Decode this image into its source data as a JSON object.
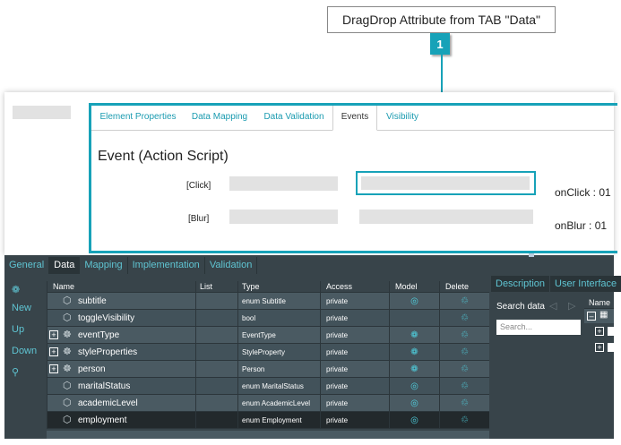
{
  "callout": {
    "text": "DragDrop Attribute from TAB \"Data\"",
    "badge": "1"
  },
  "tabs": [
    "Element Properties",
    "Data Mapping",
    "Data Validation",
    "Events",
    "Visibility"
  ],
  "active_tab": "Events",
  "heading": "Event (Action Script)",
  "events": [
    {
      "label": "[Click]",
      "value": "onClick : 01"
    },
    {
      "label": "[Blur]",
      "value": "onBlur : 01"
    }
  ],
  "bottom_tabs": [
    "General",
    "Data",
    "Mapping",
    "Implementation",
    "Validation"
  ],
  "bottom_active": "Data",
  "side_actions": {
    "new": "New",
    "up": "Up",
    "down": "Down"
  },
  "columns": [
    "Name",
    "List",
    "Type",
    "Access",
    "Model",
    "Delete"
  ],
  "rows": [
    {
      "name": "subtitle",
      "type": "enum Subtitle",
      "access": "private",
      "expand": false,
      "model": "globe"
    },
    {
      "name": "toggleVisibility",
      "type": "bool",
      "access": "private",
      "expand": false,
      "model": ""
    },
    {
      "name": "eventType",
      "type": "EventType",
      "access": "private",
      "expand": true,
      "model": "cluster"
    },
    {
      "name": "styleProperties",
      "type": "StyleProperty",
      "access": "private",
      "expand": true,
      "model": "cluster"
    },
    {
      "name": "person",
      "type": "Person",
      "access": "private",
      "expand": true,
      "model": "cluster"
    },
    {
      "name": "maritalStatus",
      "type": "enum MaritalStatus",
      "access": "private",
      "expand": false,
      "model": "globe"
    },
    {
      "name": "academicLevel",
      "type": "enum AcademicLevel",
      "access": "private",
      "expand": false,
      "model": "globe"
    },
    {
      "name": "employment",
      "type": "enum Employment",
      "access": "private",
      "expand": false,
      "model": "globe"
    }
  ],
  "right_panel": {
    "tabs": [
      "Description",
      "User Interface"
    ],
    "search_label": "Search data",
    "search_placeholder": "Search...",
    "tree_header": "Name"
  }
}
